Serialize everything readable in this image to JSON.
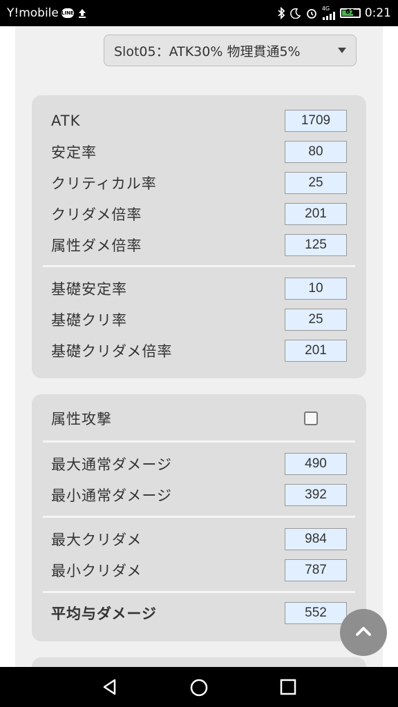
{
  "status_bar": {
    "carrier": "Y!mobile",
    "line_badge": "LINE",
    "network": "4G",
    "battery_level": "61",
    "time": "0:21"
  },
  "slot_select": {
    "value": "Slot05：ATK30% 物理貫通5%"
  },
  "stats": {
    "atk": {
      "label": "ATK",
      "value": "1709"
    },
    "stability": {
      "label": "安定率",
      "value": "80"
    },
    "crit_rate": {
      "label": "クリティカル率",
      "value": "25"
    },
    "crit_dmg_mult": {
      "label": "クリダメ倍率",
      "value": "201"
    },
    "elem_dmg_mult": {
      "label": "属性ダメ倍率",
      "value": "125"
    },
    "base_stability": {
      "label": "基礎安定率",
      "value": "10"
    },
    "base_crit": {
      "label": "基礎クリ率",
      "value": "25"
    },
    "base_crit_dmg_mult": {
      "label": "基礎クリダメ倍率",
      "value": "201"
    }
  },
  "results": {
    "elem_attack": {
      "label": "属性攻撃",
      "checked": false
    },
    "max_normal": {
      "label": "最大通常ダメージ",
      "value": "490"
    },
    "min_normal": {
      "label": "最小通常ダメージ",
      "value": "392"
    },
    "max_crit": {
      "label": "最大クリダメ",
      "value": "984"
    },
    "min_crit": {
      "label": "最小クリダメ",
      "value": "787"
    },
    "avg_damage": {
      "label": "平均与ダメージ",
      "value": "552"
    }
  },
  "colors": {
    "panel": "#dedede",
    "input_bg": "#e1efff",
    "page_bg": "#f0f0f0",
    "fab": "#8a8a8a"
  },
  "icons": [
    "line-icon",
    "upload-icon",
    "bluetooth-icon",
    "moon-icon",
    "alarm-icon",
    "signal-icon",
    "battery-icon",
    "chevron-up-icon",
    "back-icon",
    "home-icon",
    "recents-icon"
  ]
}
